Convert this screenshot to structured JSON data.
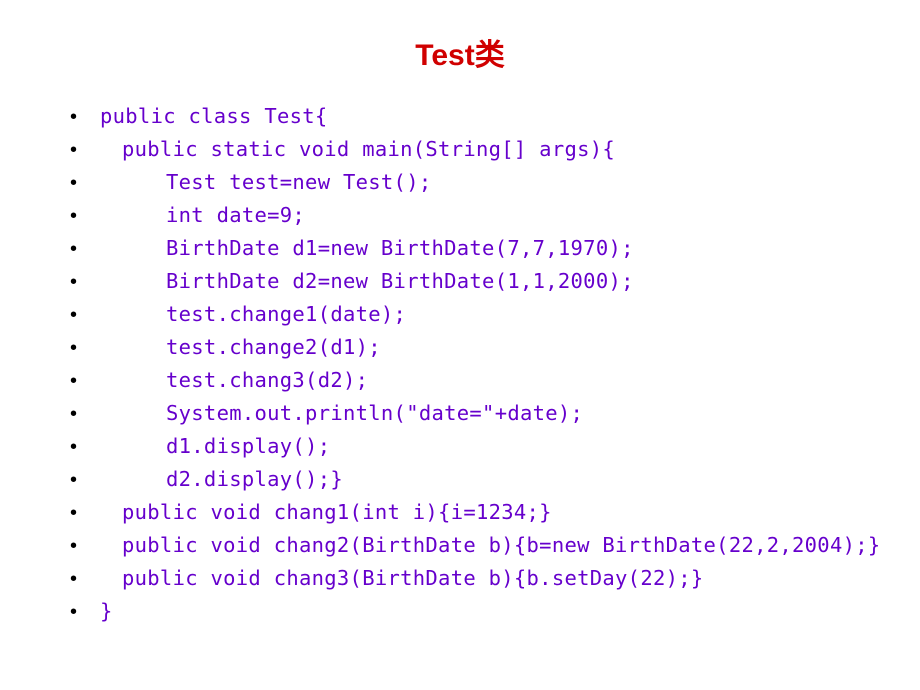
{
  "title": "Test类",
  "code": {
    "lines": [
      {
        "indent": "indent1",
        "text": "public class Test{"
      },
      {
        "indent": "indent2",
        "text": "public static void main(String[] args){"
      },
      {
        "indent": "indent3",
        "text": "Test test=new Test();"
      },
      {
        "indent": "indent3",
        "text": "int date=9;"
      },
      {
        "indent": "indent3",
        "text": "BirthDate d1=new BirthDate(7,7,1970);"
      },
      {
        "indent": "indent3",
        "text": "BirthDate d2=new BirthDate(1,1,2000);"
      },
      {
        "indent": "indent3",
        "text": "test.change1(date);"
      },
      {
        "indent": "indent3",
        "text": "test.change2(d1);"
      },
      {
        "indent": "indent3",
        "text": "test.chang3(d2);"
      },
      {
        "indent": "indent3",
        "text": "System.out.println(\"date=\"+date);"
      },
      {
        "indent": "indent3",
        "text": "d1.display();"
      },
      {
        "indent": "indent3",
        "text": "d2.display();}"
      },
      {
        "indent": "indent2",
        "text": "public void chang1(int i){i=1234;}"
      },
      {
        "indent": "indent2",
        "text": "public void chang2(BirthDate b){b=new BirthDate(22,2,2004);}"
      },
      {
        "indent": "indent2",
        "text": "public void chang3(BirthDate b){b.setDay(22);}"
      },
      {
        "indent": "indent1",
        "text": "}"
      }
    ]
  }
}
